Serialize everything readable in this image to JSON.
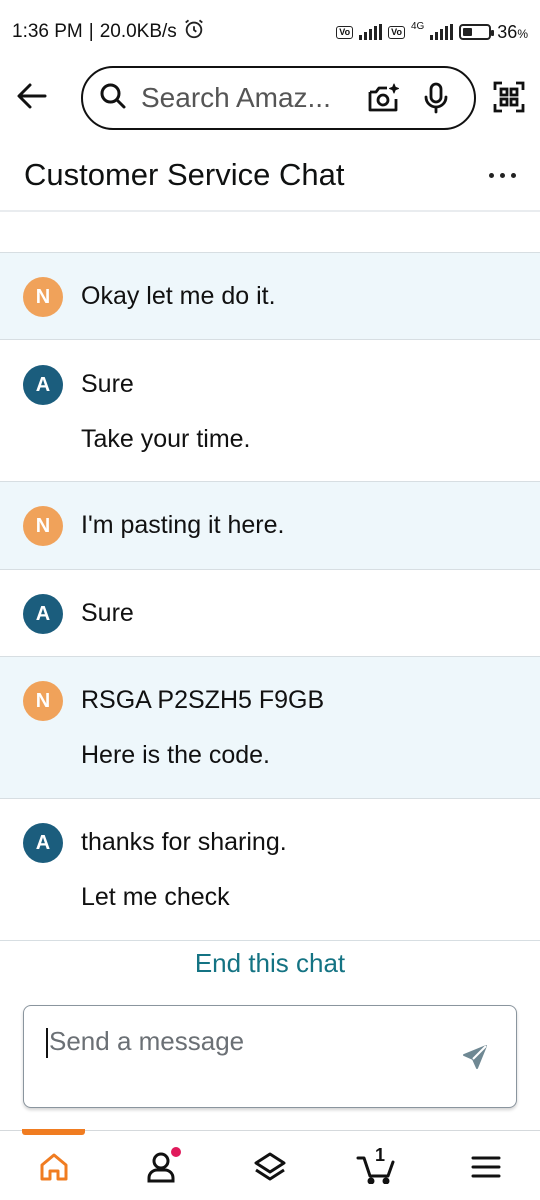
{
  "status_bar": {
    "time": "1:36 PM",
    "separator": "|",
    "speed": "20.0KB/s",
    "alarm_icon": "alarm-clock-icon",
    "volte_label": "Vo LTE",
    "network_4g": "4G",
    "battery_percent": "36",
    "battery_suffix": "%",
    "battery_level": 0.36
  },
  "header": {
    "back_icon": "arrow-left-icon",
    "search_placeholder": "Search Amaz...",
    "camera_icon": "camera-sparkle-icon",
    "mic_icon": "microphone-icon",
    "scan_icon": "qr-scan-icon"
  },
  "chat": {
    "title": "Customer Service Chat",
    "more_icon": "more-dots-icon",
    "messages": [
      {
        "sender": "user",
        "initial": "N",
        "lines": [
          "Okay let me do it."
        ]
      },
      {
        "sender": "agent",
        "initial": "A",
        "lines": [
          "Sure",
          "Take your time."
        ]
      },
      {
        "sender": "user",
        "initial": "N",
        "lines": [
          "I'm pasting it here."
        ]
      },
      {
        "sender": "agent",
        "initial": "A",
        "lines": [
          "Sure"
        ]
      },
      {
        "sender": "user",
        "initial": "N",
        "lines": [
          "RSGA P2SZH5 F9GB",
          "Here is the code."
        ]
      },
      {
        "sender": "agent",
        "initial": "A",
        "lines": [
          "thanks for sharing.",
          "Let me check"
        ]
      }
    ],
    "end_chat_label": "End this chat"
  },
  "composer": {
    "placeholder": "Send a message",
    "send_icon": "send-arrow-icon"
  },
  "bottom_nav": {
    "items": [
      {
        "name": "home",
        "icon": "home-icon",
        "active": true
      },
      {
        "name": "account",
        "icon": "person-icon",
        "badge": true
      },
      {
        "name": "inspire",
        "icon": "layers-icon"
      },
      {
        "name": "cart",
        "icon": "cart-icon",
        "count": "1"
      },
      {
        "name": "menu",
        "icon": "hamburger-menu-icon"
      }
    ]
  },
  "colors": {
    "user_bg": "#eef7fb",
    "avatar_user": "#f0a25a",
    "avatar_agent": "#1b5d7d",
    "link": "#147383",
    "nav_active": "#f07c21",
    "badge": "#e01a5b"
  }
}
